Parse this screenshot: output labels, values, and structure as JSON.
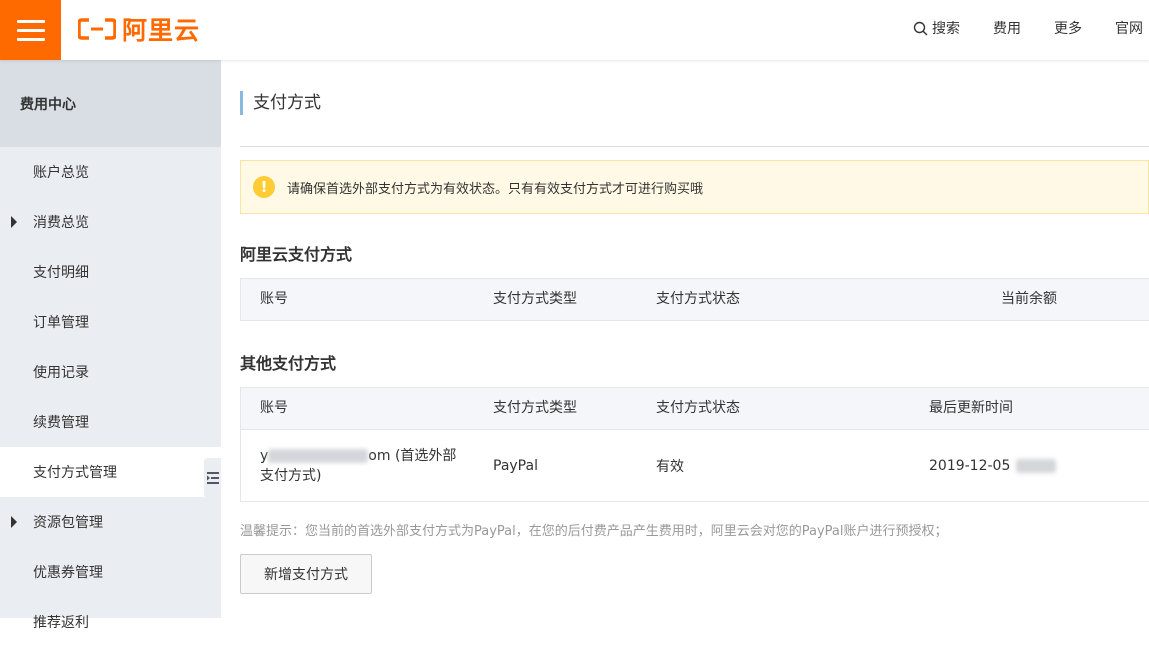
{
  "header": {
    "brand": "阿里云",
    "nav": {
      "search": "搜索",
      "cost": "费用",
      "more": "更多",
      "official": "官网"
    }
  },
  "sidebar": {
    "title": "费用中心",
    "items": [
      {
        "label": "账户总览",
        "expandable": false,
        "active": false
      },
      {
        "label": "消费总览",
        "expandable": true,
        "active": false
      },
      {
        "label": "支付明细",
        "expandable": false,
        "active": false
      },
      {
        "label": "订单管理",
        "expandable": false,
        "active": false
      },
      {
        "label": "使用记录",
        "expandable": false,
        "active": false
      },
      {
        "label": "续费管理",
        "expandable": false,
        "active": false
      },
      {
        "label": "支付方式管理",
        "expandable": false,
        "active": true
      },
      {
        "label": "资源包管理",
        "expandable": true,
        "active": false
      },
      {
        "label": "优惠券管理",
        "expandable": false,
        "active": false
      },
      {
        "label": "推荐返利",
        "expandable": false,
        "active": false
      }
    ]
  },
  "main": {
    "title": "支付方式",
    "notice": "请确保首选外部支付方式为有效状态。只有有效支付方式才可进行购买哦",
    "aliyun_section": {
      "title": "阿里云支付方式",
      "columns": [
        "账号",
        "支付方式类型",
        "支付方式状态",
        "当前余额"
      ]
    },
    "other_section": {
      "title": "其他支付方式",
      "columns": [
        "账号",
        "支付方式类型",
        "支付方式状态",
        "最后更新时间"
      ],
      "rows": [
        {
          "account_prefix": "y",
          "account_suffix": "om (首选外部支付方式)",
          "type": "PayPal",
          "status": "有效",
          "updated": "2019-12-05"
        }
      ]
    },
    "tip": "温馨提示：您当前的首选外部支付方式为PayPal，在您的后付费产品产生费用时，阿里云会对您的PayPal账户进行预授权；",
    "add_button": "新增支付方式"
  },
  "colors": {
    "brand_orange": "#ff6a00",
    "sidebar_bg": "#eaedf1",
    "notice_bg": "#fff9e6",
    "warn_yellow": "#ffcc33"
  }
}
